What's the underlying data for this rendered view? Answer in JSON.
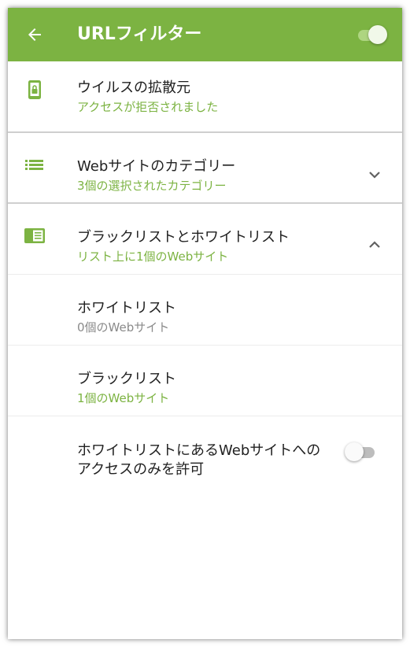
{
  "appbar": {
    "title": "URLフィルター",
    "back_icon": "arrow-back-icon",
    "filter_enabled": true
  },
  "colors": {
    "accent": "#7cb342",
    "toggle_on_track": "#aed581",
    "toggle_off_track": "#bdbdbd",
    "primary_text": "#212121",
    "secondary_text": "#8a8a8a"
  },
  "items": {
    "virus_sources": {
      "title": "ウイルスの拡散元",
      "subtitle": "アクセスが拒否されました",
      "icon": "phone-lock-icon"
    },
    "categories": {
      "title": "Webサイトのカテゴリー",
      "subtitle": "3個の選択されたカテゴリー",
      "icon": "list-icon",
      "expanded": false
    },
    "lists": {
      "title": "ブラックリストとホワイトリスト",
      "subtitle": "リスト上に1個のWebサイト",
      "icon": "list-card-icon",
      "expanded": true
    },
    "whitelist": {
      "title": "ホワイトリスト",
      "subtitle": "0個のWebサイト"
    },
    "blacklist": {
      "title": "ブラックリスト",
      "subtitle": "1個のWebサイト"
    },
    "allow_whitelist_only": {
      "line1": "ホワイトリストにあるWebサイトへの",
      "line2": "アクセスのみを許可",
      "enabled": false
    }
  }
}
